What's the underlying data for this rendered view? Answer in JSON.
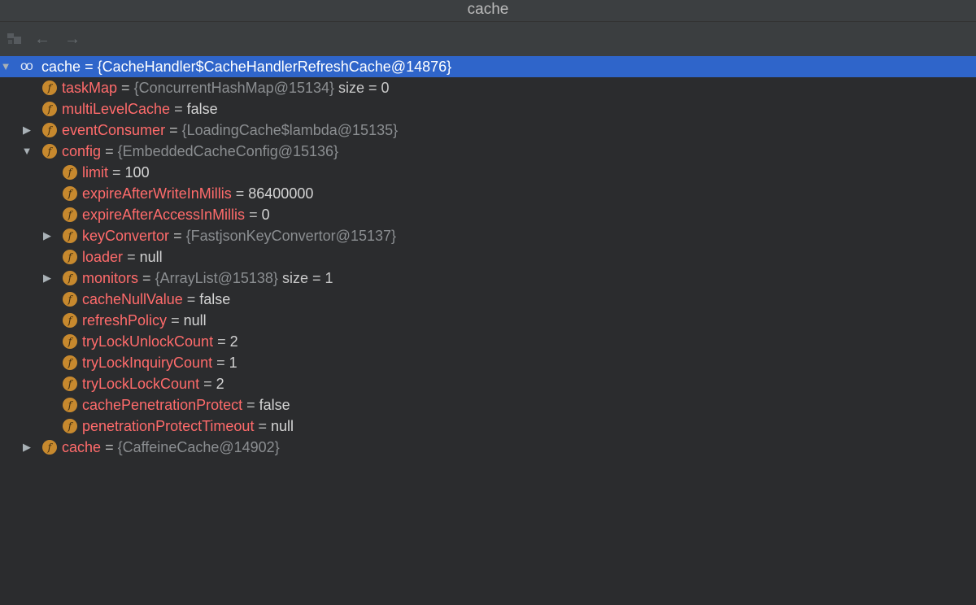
{
  "window": {
    "title": "cache"
  },
  "toolbar": {
    "icons": [
      "watches-icon",
      "back-arrow-icon",
      "forward-arrow-icon"
    ],
    "back_glyph": "←",
    "forward_glyph": "→"
  },
  "tree": {
    "root": {
      "name": "cache",
      "eq": "=",
      "value": "{CacheHandler$CacheHandlerRefreshCache@14876}"
    },
    "rows": [
      {
        "name": "taskMap",
        "eq": "=",
        "value": "{ConcurrentHashMap@15134}",
        "extra": "size = 0"
      },
      {
        "name": "multiLevelCache",
        "eq": "=",
        "value": "false"
      },
      {
        "name": "eventConsumer",
        "eq": "=",
        "value": "{LoadingCache$lambda@15135}"
      },
      {
        "name": "config",
        "eq": "=",
        "value": "{EmbeddedCacheConfig@15136}"
      },
      {
        "name": "limit",
        "eq": "=",
        "value": "100"
      },
      {
        "name": "expireAfterWriteInMillis",
        "eq": "=",
        "value": "86400000"
      },
      {
        "name": "expireAfterAccessInMillis",
        "eq": "=",
        "value": "0"
      },
      {
        "name": "keyConvertor",
        "eq": "=",
        "value": "{FastjsonKeyConvertor@15137}"
      },
      {
        "name": "loader",
        "eq": "=",
        "value": "null"
      },
      {
        "name": "monitors",
        "eq": "=",
        "value": "{ArrayList@15138}",
        "extra": "size = 1"
      },
      {
        "name": "cacheNullValue",
        "eq": "=",
        "value": "false"
      },
      {
        "name": "refreshPolicy",
        "eq": "=",
        "value": "null"
      },
      {
        "name": "tryLockUnlockCount",
        "eq": "=",
        "value": "2"
      },
      {
        "name": "tryLockInquiryCount",
        "eq": "=",
        "value": "1"
      },
      {
        "name": "tryLockLockCount",
        "eq": "=",
        "value": "2"
      },
      {
        "name": "cachePenetrationProtect",
        "eq": "=",
        "value": "false"
      },
      {
        "name": "penetrationProtectTimeout",
        "eq": "=",
        "value": "null"
      },
      {
        "name": "cache",
        "eq": "=",
        "value": "{CaffeineCache@14902}"
      }
    ],
    "field_icon_letter": "f",
    "watch_glyph": "oo",
    "expanded_glyph": "▼",
    "collapsed_glyph": "▶"
  },
  "colors": {
    "selection": "#2f65ca",
    "field_name": "#ff6b6b",
    "field_icon": "#c7892e",
    "background": "#2b2c2e"
  }
}
